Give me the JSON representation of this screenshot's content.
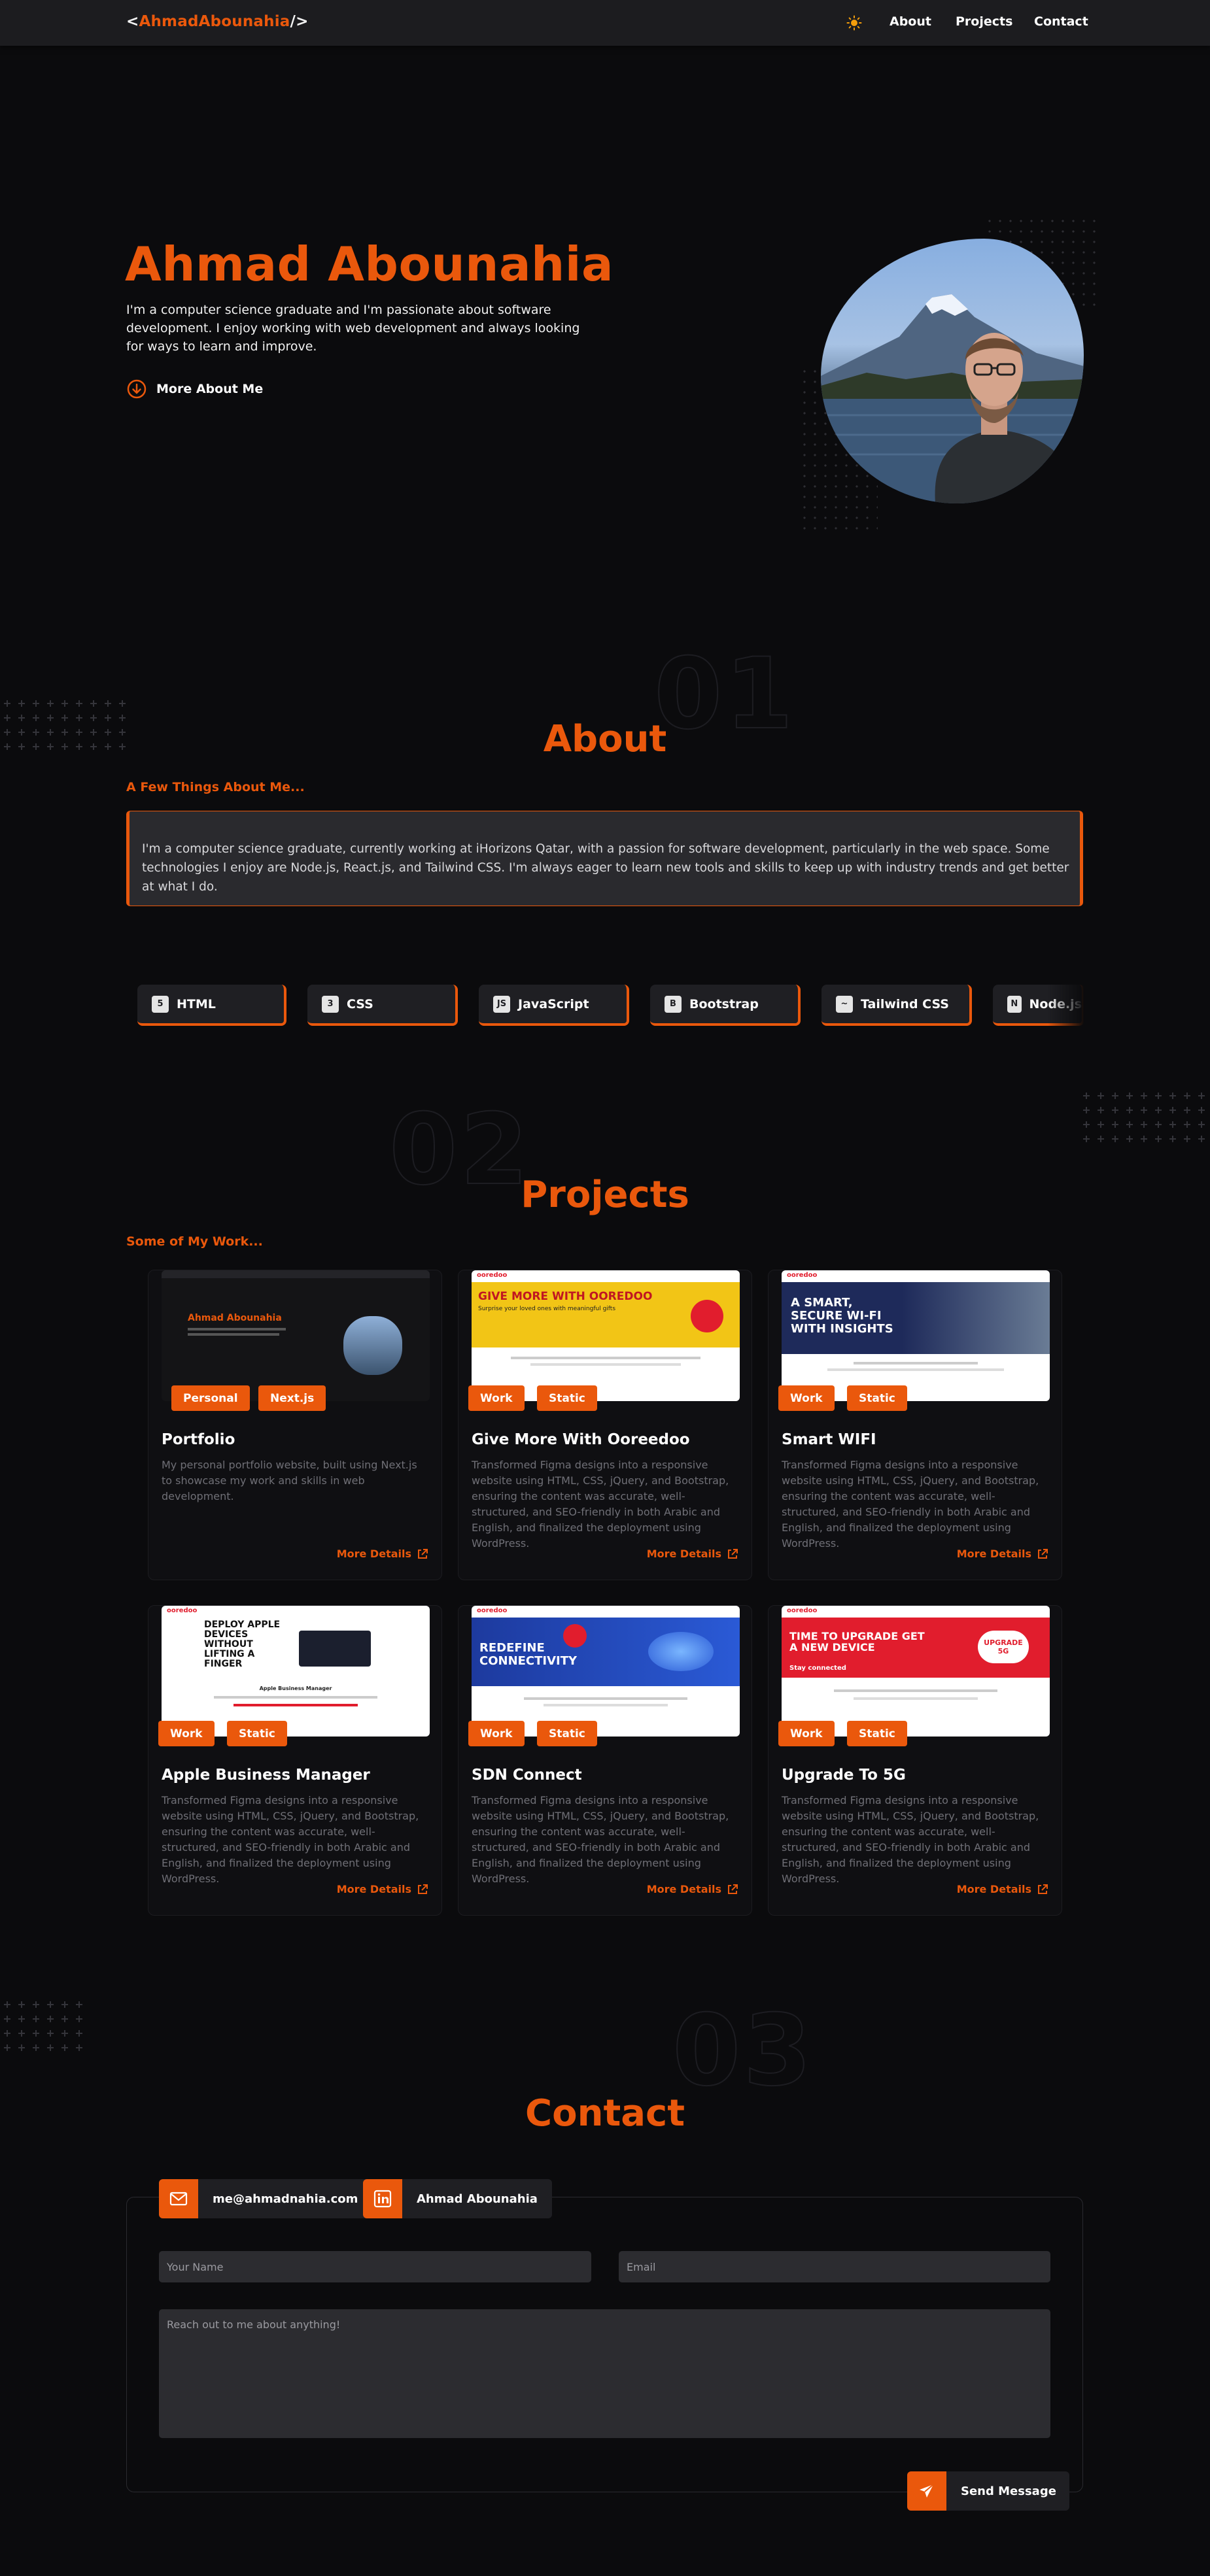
{
  "nav": {
    "logo_open": "<",
    "logo_name": "AhmadAbounahia",
    "logo_close": "/>",
    "theme_icon": "sun-icon",
    "links": [
      "About",
      "Projects",
      "Contact"
    ]
  },
  "hero": {
    "name": "Ahmad Abounahia",
    "description": "I'm a computer science graduate and I'm passionate about software development. I enjoy working with web development and always looking for ways to learn and improve.",
    "cta": "More About Me",
    "cta_icon": "arrow-down-circle-icon"
  },
  "about": {
    "number": "01",
    "title": "About",
    "subtitle": "A Few Things About Me...",
    "body": "I'm a computer science graduate, currently working at iHorizons Qatar, with a passion for software development, particularly in the web space. Some technologies I enjoy are Node.js, React.js, and Tailwind CSS. I'm always eager to learn new tools and skills to keep up with industry trends and get better at what I do.",
    "skills": [
      "HTML",
      "CSS",
      "JavaScript",
      "Bootstrap",
      "Tailwind CSS",
      "Node.js"
    ]
  },
  "projects": {
    "number": "02",
    "title": "Projects",
    "subtitle": "Some of My Work...",
    "more_label": "More Details",
    "items": [
      {
        "title": "Portfolio",
        "tags": [
          "Personal",
          "Next.js"
        ],
        "description": "My personal portfolio website, built using Next.js to showcase my work and skills in web development."
      },
      {
        "title": "Give More With Ooreedoo",
        "tags": [
          "Work",
          "Static"
        ],
        "description": "Transformed Figma designs into a responsive website using HTML, CSS, jQuery, and Bootstrap, ensuring the content was accurate, well-structured, and SEO-friendly in both Arabic and English, and finalized the deployment using WordPress."
      },
      {
        "title": "Smart WIFI",
        "tags": [
          "Work",
          "Static"
        ],
        "description": "Transformed Figma designs into a responsive website using HTML, CSS, jQuery, and Bootstrap, ensuring the content was accurate, well-structured, and SEO-friendly in both Arabic and English, and finalized the deployment using WordPress."
      },
      {
        "title": "Apple Business Manager",
        "tags": [
          "Work",
          "Static"
        ],
        "description": "Transformed Figma designs into a responsive website using HTML, CSS, jQuery, and Bootstrap, ensuring the content was accurate, well-structured, and SEO-friendly in both Arabic and English, and finalized the deployment using WordPress."
      },
      {
        "title": "SDN Connect",
        "tags": [
          "Work",
          "Static"
        ],
        "description": "Transformed Figma designs into a responsive website using HTML, CSS, jQuery, and Bootstrap, ensuring the content was accurate, well-structured, and SEO-friendly in both Arabic and English, and finalized the deployment using WordPress."
      },
      {
        "title": "Upgrade To 5G",
        "tags": [
          "Work",
          "Static"
        ],
        "description": "Transformed Figma designs into a responsive website using HTML, CSS, jQuery, and Bootstrap, ensuring the content was accurate, well-structured, and SEO-friendly in both Arabic and English, and finalized the deployment using WordPress."
      }
    ],
    "thumbs": {
      "portfolio": {
        "name": "Ahmad Abounahia"
      },
      "ooredoo_give": {
        "brand": "ooredoo",
        "headline": "GIVE MORE WITH OOREDOO",
        "sub": "Surprise your loved ones with meaningful gifts"
      },
      "smart_wifi": {
        "brand": "ooredoo",
        "headline": "A SMART, SECURE WI-FI WITH INSIGHTS"
      },
      "apple_bm": {
        "brand": "ooredoo",
        "headline": "DEPLOY APPLE DEVICES WITHOUT LIFTING A FINGER",
        "sub": "Apple Business Manager"
      },
      "sdn": {
        "brand": "ooredoo",
        "headline": "REDEFINE CONNECTIVITY"
      },
      "fiveg": {
        "brand": "ooredoo",
        "headline": "TIME TO UPGRADE GET A NEW DEVICE",
        "sub": "Stay connected",
        "badge": "UPGRADE 5G"
      }
    }
  },
  "contact": {
    "number": "03",
    "title": "Contact",
    "email": "me@ahmadnahia.com",
    "linkedin": "Ahmad Abounahia",
    "name_placeholder": "Your Name",
    "email_placeholder": "Email",
    "message_placeholder": "Reach out to me about anything!",
    "send_label": "Send Message"
  },
  "colors": {
    "accent": "#ea580c",
    "background": "#0b0b0d",
    "surface": "#1f1f23"
  }
}
